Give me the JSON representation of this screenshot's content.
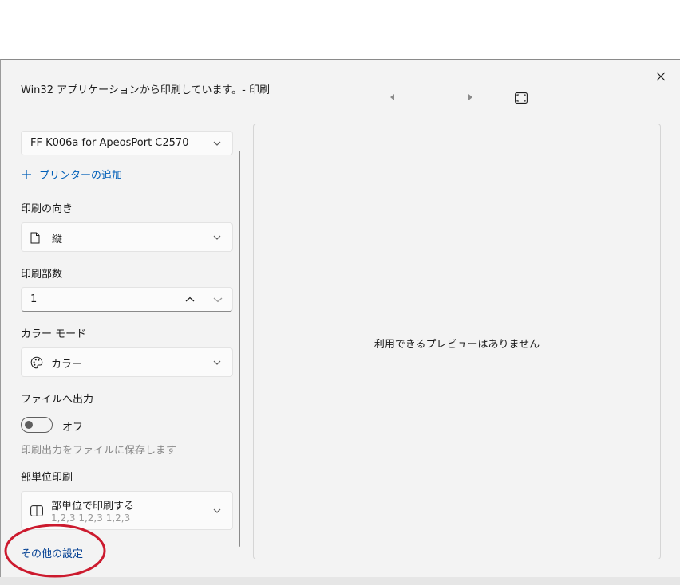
{
  "dialog": {
    "title": "Win32 アプリケーションから印刷しています。- 印刷",
    "close_icon": "close-icon",
    "nav": {
      "prev_icon": "triangle-left-icon",
      "next_icon": "triangle-right-icon",
      "fit_icon": "fit-to-page-icon"
    }
  },
  "printer": {
    "selected": "FF K006a for ApeosPort C2570",
    "add_label": "プリンターの追加"
  },
  "orientation": {
    "label": "印刷の向き",
    "value": "縦",
    "icon": "page-icon"
  },
  "copies": {
    "label": "印刷部数",
    "value": "1"
  },
  "color_mode": {
    "label": "カラー モード",
    "value": "カラー",
    "icon": "palette-icon"
  },
  "print_to_file": {
    "label": "ファイルへ出力",
    "state": "オフ",
    "description": "印刷出力をファイルに保存します"
  },
  "collation": {
    "label": "部単位印刷",
    "value": "部単位で印刷する",
    "sub": "1,2,3   1,2,3   1,2,3",
    "icon": "collate-icon"
  },
  "more_settings": "その他の設定",
  "preview": {
    "message": "利用できるプレビューはありません"
  },
  "highlight_color": "#cc1a2e"
}
